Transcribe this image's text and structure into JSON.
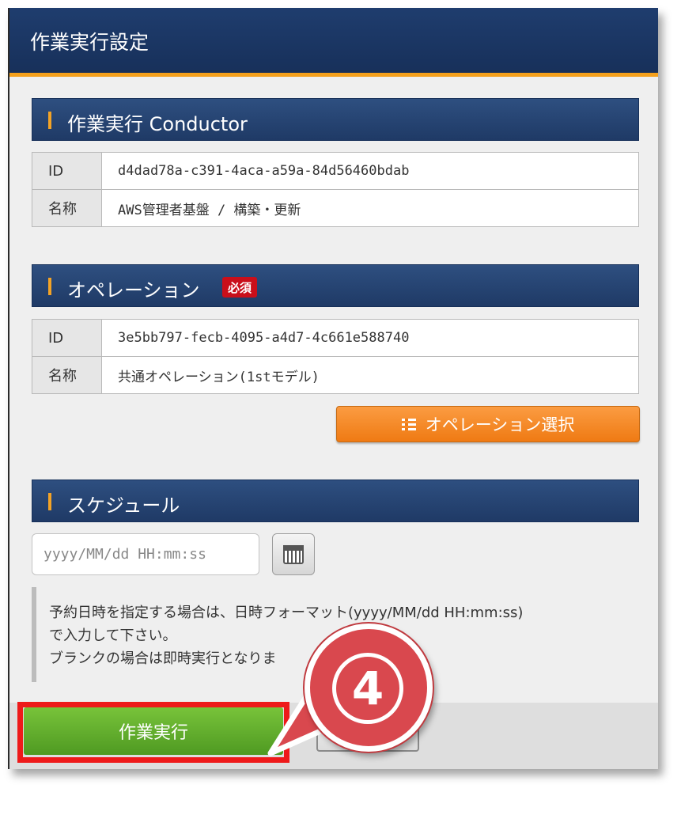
{
  "dialog": {
    "title": "作業実行設定"
  },
  "conductor_section": {
    "heading": "作業実行 Conductor",
    "rows": [
      {
        "key": "ID",
        "value": "d4dad78a-c391-4aca-a59a-84d56460bdab"
      },
      {
        "key": "名称",
        "value": "AWS管理者基盤 / 構築・更新"
      }
    ]
  },
  "operation_section": {
    "heading": "オペレーション",
    "required_badge": "必須",
    "rows": [
      {
        "key": "ID",
        "value": "3e5bb797-fecb-4095-a4d7-4c661e588740"
      },
      {
        "key": "名称",
        "value": "共通オペレーション(1stモデル)"
      }
    ],
    "select_button": "オペレーション選択"
  },
  "schedule_section": {
    "heading": "スケジュール",
    "input_placeholder": "yyyy/MM/dd HH:mm:ss",
    "notice_lines": [
      "予約日時を指定する場合は、日時フォーマット(yyyy/MM/dd HH:mm:ss)",
      "で入力して下さい。",
      "ブランクの場合は即時実行となりま"
    ]
  },
  "footer": {
    "execute_button": "作業実行"
  },
  "callout": {
    "number": "4"
  },
  "colors": {
    "header": "#1f3d6e",
    "accent": "#f4a01c",
    "execute": "#5ea92b",
    "highlight": "#ee1a1a",
    "callout": "#d9484e"
  }
}
